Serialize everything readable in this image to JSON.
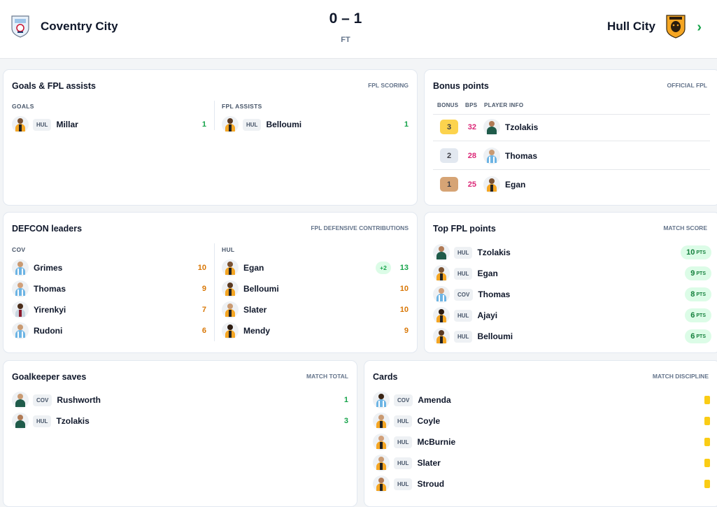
{
  "match": {
    "home_team": "Coventry City",
    "away_team": "Hull City",
    "score": "0 – 1",
    "status": "FT"
  },
  "goals_card": {
    "title": "Goals & FPL assists",
    "subtitle": "FPL SCORING",
    "goals_header": "GOALS",
    "assists_header": "FPL ASSISTS",
    "goals": [
      {
        "team": "HUL",
        "name": "Millar",
        "value": "1"
      }
    ],
    "assists": [
      {
        "team": "HUL",
        "name": "Belloumi",
        "value": "1"
      }
    ]
  },
  "bonus_card": {
    "title": "Bonus points",
    "subtitle": "OFFICIAL FPL",
    "headers": [
      "BONUS",
      "BPS",
      "PLAYER INFO"
    ],
    "rows": [
      {
        "bonus": "3",
        "bps": "32",
        "name": "Tzolakis",
        "badge_color": "#fcd34d"
      },
      {
        "bonus": "2",
        "bps": "28",
        "name": "Thomas",
        "badge_color": "#e2e8f0"
      },
      {
        "bonus": "1",
        "bps": "25",
        "name": "Egan",
        "badge_color": "#d6a475"
      }
    ]
  },
  "defcon_card": {
    "title": "DEFCON leaders",
    "subtitle": "FPL DEFENSIVE CONTRIBUTIONS",
    "home_header": "COV",
    "away_header": "HUL",
    "home": [
      {
        "name": "Grimes",
        "value": "10"
      },
      {
        "name": "Thomas",
        "value": "9"
      },
      {
        "name": "Yirenkyi",
        "value": "7"
      },
      {
        "name": "Rudoni",
        "value": "6"
      }
    ],
    "away": [
      {
        "name": "Egan",
        "value": "13",
        "extra": "+2"
      },
      {
        "name": "Belloumi",
        "value": "10"
      },
      {
        "name": "Slater",
        "value": "10"
      },
      {
        "name": "Mendy",
        "value": "9"
      }
    ]
  },
  "top_card": {
    "title": "Top FPL points",
    "subtitle": "MATCH SCORE",
    "unit": "PTS",
    "rows": [
      {
        "team": "HUL",
        "name": "Tzolakis",
        "points": "10"
      },
      {
        "team": "HUL",
        "name": "Egan",
        "points": "9"
      },
      {
        "team": "COV",
        "name": "Thomas",
        "points": "8"
      },
      {
        "team": "HUL",
        "name": "Ajayi",
        "points": "6"
      },
      {
        "team": "HUL",
        "name": "Belloumi",
        "points": "6"
      }
    ]
  },
  "gk_card": {
    "title": "Goalkeeper saves",
    "subtitle": "MATCH TOTAL",
    "rows": [
      {
        "team": "COV",
        "name": "Rushworth",
        "value": "1"
      },
      {
        "team": "HUL",
        "name": "Tzolakis",
        "value": "3"
      }
    ]
  },
  "cards_card": {
    "title": "Cards",
    "subtitle": "MATCH DISCIPLINE",
    "rows": [
      {
        "team": "COV",
        "name": "Amenda",
        "card": "yellow"
      },
      {
        "team": "HUL",
        "name": "Coyle",
        "card": "yellow"
      },
      {
        "team": "HUL",
        "name": "McBurnie",
        "card": "yellow"
      },
      {
        "team": "HUL",
        "name": "Slater",
        "card": "yellow"
      },
      {
        "team": "HUL",
        "name": "Stroud",
        "card": "yellow"
      }
    ]
  },
  "icons": {
    "home_crest": "coventry-crest-icon",
    "away_crest": "hull-crest-icon",
    "next": "chevron-right-icon",
    "player": "player-avatar-icon"
  }
}
